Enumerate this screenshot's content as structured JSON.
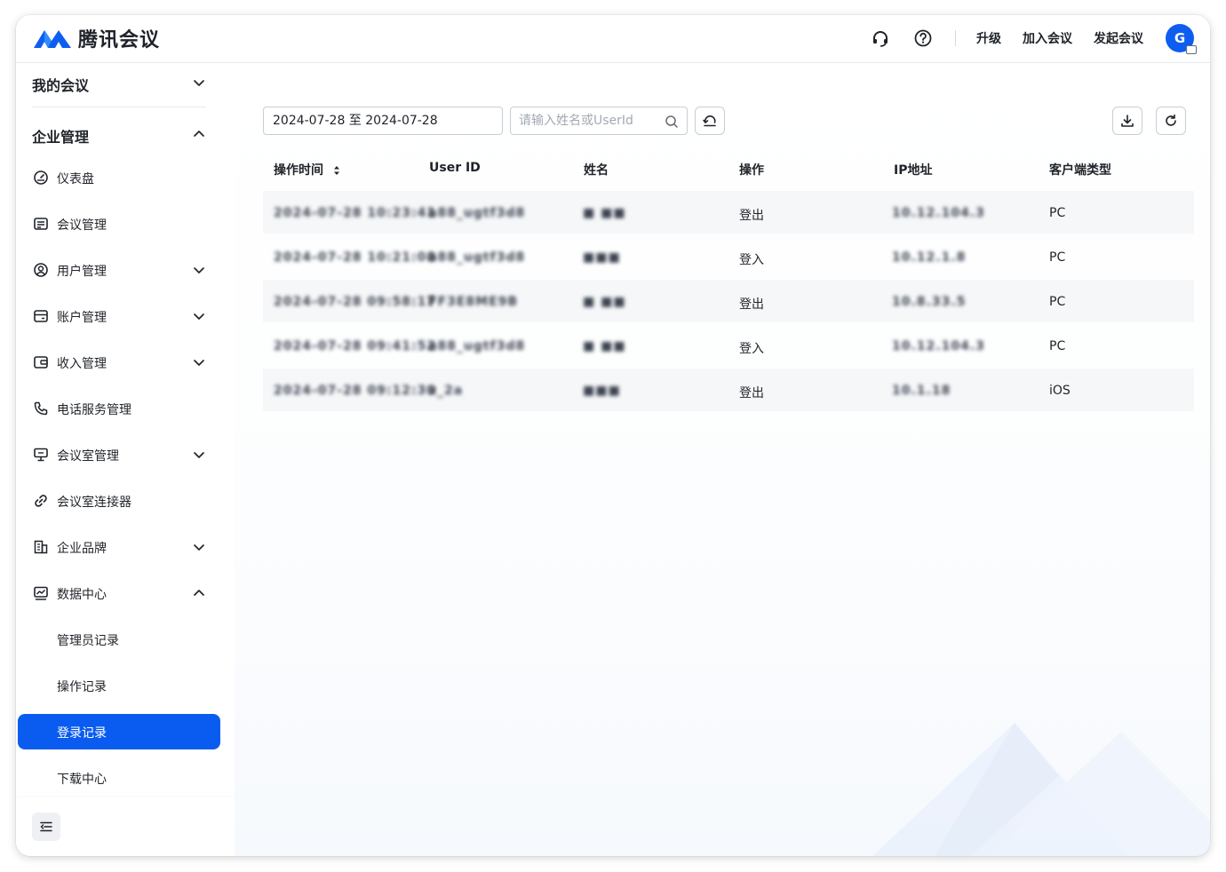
{
  "header": {
    "app_name": "腾讯会议",
    "upgrade": "升级",
    "join_meeting": "加入会议",
    "start_meeting": "发起会议",
    "avatar_letter": "G",
    "brand_color": "#0d5ef0"
  },
  "sidebar": {
    "my_meetings": "我的会议",
    "enterprise": "企业管理",
    "items": [
      {
        "label": "仪表盘",
        "icon": "dashboard-icon"
      },
      {
        "label": "会议管理",
        "icon": "list-icon"
      },
      {
        "label": "用户管理",
        "icon": "user-icon"
      },
      {
        "label": "账户管理",
        "icon": "account-icon"
      },
      {
        "label": "收入管理",
        "icon": "wallet-icon"
      },
      {
        "label": "电话服务管理",
        "icon": "phone-icon"
      },
      {
        "label": "会议室管理",
        "icon": "room-icon"
      },
      {
        "label": "会议室连接器",
        "icon": "link-icon"
      },
      {
        "label": "企业品牌",
        "icon": "building-icon"
      },
      {
        "label": "数据中心",
        "icon": "chart-icon"
      }
    ],
    "sub_items": [
      "管理员记录",
      "操作记录",
      "登录记录",
      "下载中心"
    ],
    "active_item": "登录记录",
    "active_color": "#0a5cf0"
  },
  "filters": {
    "date_range": "2024-07-28 至 2024-07-28",
    "search_placeholder": "请输入姓名或UserId"
  },
  "table": {
    "columns": [
      "操作时间",
      "User ID",
      "姓名",
      "操作",
      "IP地址",
      "客户端类型"
    ],
    "rows": [
      {
        "time": "2024-07-28 10:23:41",
        "user_id": "a88_ugtf3d8",
        "name": "■ ■■",
        "action": "登出",
        "ip": "10.12.104.3",
        "client": "PC"
      },
      {
        "time": "2024-07-28 10:21:08",
        "user_id": "a88_ugtf3d8",
        "name": "■■■",
        "action": "登入",
        "ip": "10.12.1.8",
        "client": "PC"
      },
      {
        "time": "2024-07-28 09:58:17",
        "user_id": "FF3E8ME9B",
        "name": "■ ■■",
        "action": "登出",
        "ip": "10.8.33.5",
        "client": "PC"
      },
      {
        "time": "2024-07-28 09:41:52",
        "user_id": "a88_ugtf3d8",
        "name": "■ ■■",
        "action": "登入",
        "ip": "10.12.104.3",
        "client": "PC"
      },
      {
        "time": "2024-07-28 09:12:30",
        "user_id": "x_2a",
        "name": "■■■",
        "action": "登出",
        "ip": "10.1.18",
        "client": "iOS"
      }
    ]
  }
}
